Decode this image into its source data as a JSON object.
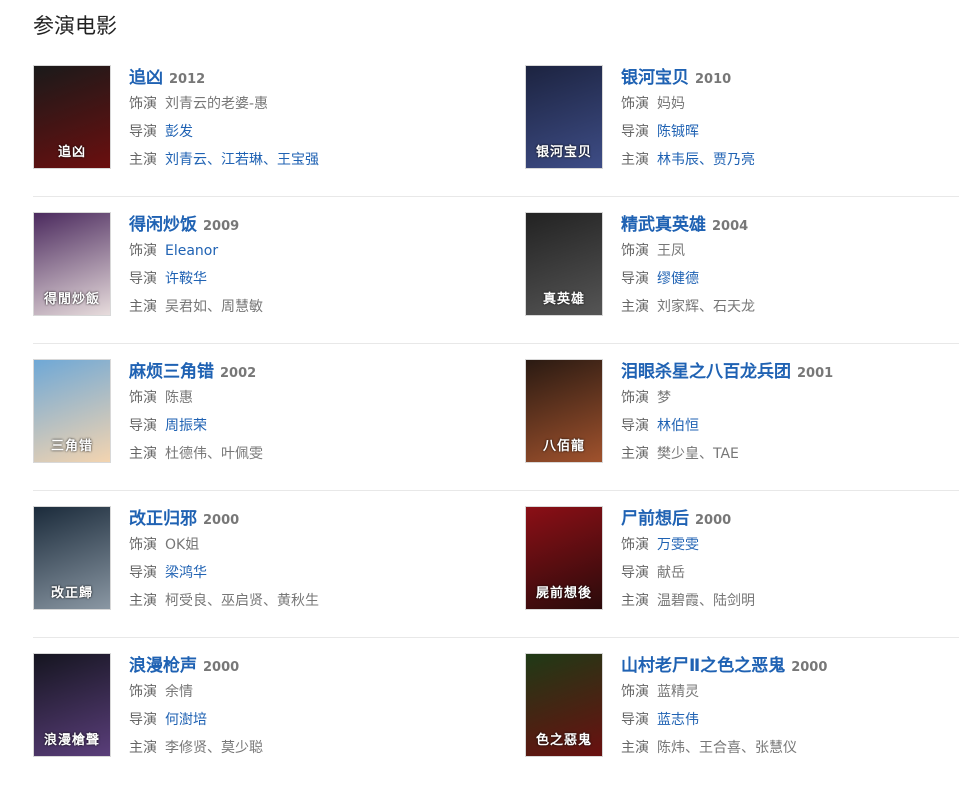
{
  "section_title": "参演电影",
  "labels": {
    "role": "饰演",
    "director": "导演",
    "cast": "主演"
  },
  "movies": [
    {
      "title": "追凶",
      "year": "2012",
      "role": "刘青云的老婆-惠",
      "role_link": false,
      "director": "彭发",
      "director_link": true,
      "cast": "刘青云、江若琳、王宝强",
      "cast_link": true,
      "poster_colors": [
        "#1a1a1a",
        "#6b0f0f"
      ],
      "poster_text": "追凶"
    },
    {
      "title": "银河宝贝",
      "year": "2010",
      "role": "妈妈",
      "role_link": false,
      "director": "陈铖晖",
      "director_link": true,
      "cast": "林韦辰、贾乃亮",
      "cast_link": true,
      "poster_colors": [
        "#1c2340",
        "#3e4d86"
      ],
      "poster_text": "银河宝贝"
    },
    {
      "title": "得闲炒饭",
      "year": "2009",
      "role": "Eleanor",
      "role_link": true,
      "director": "许鞍华",
      "director_link": true,
      "cast": "吴君如、周慧敏",
      "cast_link": false,
      "poster_colors": [
        "#4b2a5e",
        "#e7dcdc"
      ],
      "poster_text": "得閒炒飯"
    },
    {
      "title": "精武真英雄",
      "year": "2004",
      "role": "王凤",
      "role_link": false,
      "director": "缪健德",
      "director_link": true,
      "cast": "刘家辉、石天龙",
      "cast_link": false,
      "poster_colors": [
        "#222222",
        "#555555"
      ],
      "poster_text": "真英雄"
    },
    {
      "title": "麻烦三角错",
      "year": "2002",
      "role": "陈惠",
      "role_link": false,
      "director": "周振荣",
      "director_link": true,
      "cast": "杜德伟、叶佩雯",
      "cast_link": false,
      "poster_colors": [
        "#6fa8d6",
        "#f3d4b0"
      ],
      "poster_text": "三角错"
    },
    {
      "title": "泪眼杀星之八百龙兵团",
      "year": "2001",
      "role": "梦",
      "role_link": false,
      "director": "林伯恒",
      "director_link": true,
      "cast": "樊少皇、TAE",
      "cast_link": false,
      "poster_colors": [
        "#2a1a12",
        "#a0522d"
      ],
      "poster_text": "八佰龍"
    },
    {
      "title": "改正归邪",
      "year": "2000",
      "role": "OK姐",
      "role_link": false,
      "director": "梁鸿华",
      "director_link": true,
      "cast": "柯受良、巫启贤、黄秋生",
      "cast_link": false,
      "poster_colors": [
        "#1b2b3b",
        "#8a97a3"
      ],
      "poster_text": "改正歸"
    },
    {
      "title": "尸前想后",
      "year": "2000",
      "role": "万雯雯",
      "role_link": true,
      "director": "献岳",
      "director_link": false,
      "cast": "温碧霞、陆剑明",
      "cast_link": false,
      "poster_colors": [
        "#8b0f16",
        "#2b0b0b"
      ],
      "poster_text": "屍前想後"
    },
    {
      "title": "浪漫枪声",
      "year": "2000",
      "role": "余情",
      "role_link": false,
      "director": "何澍培",
      "director_link": true,
      "cast": "李修贤、莫少聪",
      "cast_link": false,
      "poster_colors": [
        "#151520",
        "#5a3e7a"
      ],
      "poster_text": "浪漫槍聲"
    },
    {
      "title": "山村老尸Ⅱ之色之恶鬼",
      "year": "2000",
      "role": "蓝精灵",
      "role_link": false,
      "director": "蓝志伟",
      "director_link": true,
      "cast": "陈炜、王合喜、张慧仪",
      "cast_link": false,
      "poster_colors": [
        "#1f3a16",
        "#6a1010"
      ],
      "poster_text": "色之惡鬼"
    }
  ]
}
